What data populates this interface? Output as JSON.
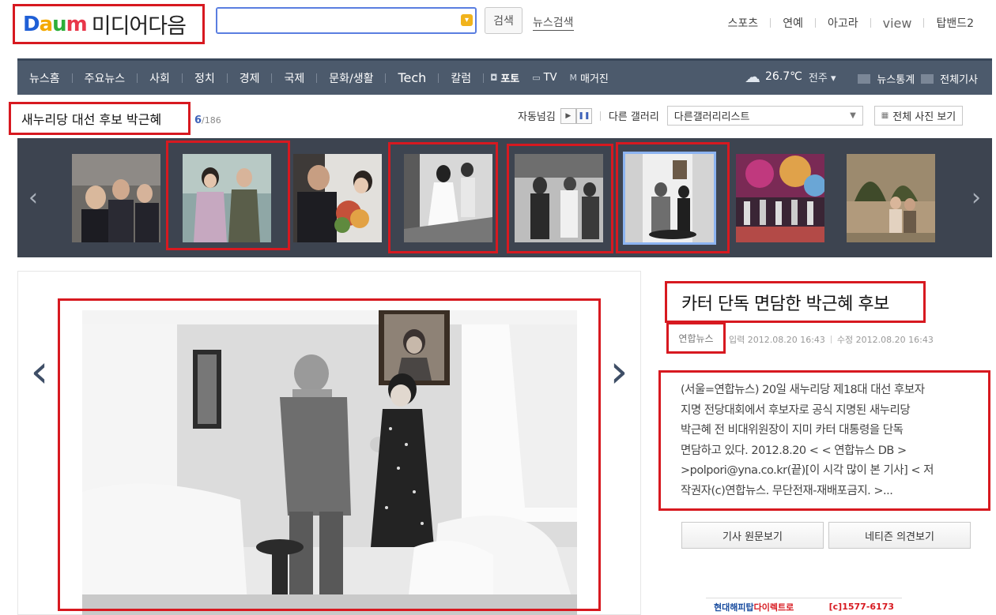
{
  "header": {
    "logo_brand": "Daum",
    "logo_text": "미디어다음",
    "search_value": "",
    "search_button": "검색",
    "news_search": "뉴스검색",
    "top_links": [
      "스포츠",
      "연예",
      "아고라",
      "view",
      "탑밴드2"
    ]
  },
  "nav": {
    "items": [
      "뉴스홈",
      "주요뉴스",
      "사회",
      "정치",
      "경제",
      "국제",
      "문화/생활",
      "Tech",
      "칼럼"
    ],
    "sub_items": [
      {
        "label": "포토",
        "icon": "camera-icon",
        "active": true
      },
      {
        "label": "TV",
        "icon": "tv-icon",
        "active": false
      },
      {
        "label": "매거진",
        "icon": "magazine-icon",
        "active": false
      }
    ],
    "weather": {
      "temp": "26.7℃",
      "city": "전주",
      "icon": "partly-cloudy-icon"
    },
    "right_links": [
      "뉴스통계",
      "전체기사"
    ]
  },
  "gallery": {
    "title": "새누리당 대선 후보 박근혜",
    "current": "6",
    "total": "/186",
    "autoplay_label": "자동넘김",
    "other_gallery_label": "다른 갤러리",
    "other_gallery_select": "다른갤러리리스트",
    "view_all": "전체 사진 보기"
  },
  "article": {
    "title": "카터 단독 면담한 박근혜 후보",
    "source": "연합뉴스",
    "input_time": "입력 2012.08.20 16:43",
    "edit_time": "수정 2012.08.20 16:43",
    "body_lines": [
      "(서울=연합뉴스) 20일 새누리당 제18대 대선 후보자",
      "지명 전당대회에서 후보자로 공식 지명된 새누리당",
      "박근혜 전 비대위원장이 지미 카터 대통령을 단독",
      "면담하고 있다. 2012.8.20 < < 연합뉴스 DB >",
      ">polpori@yna.co.kr(끝)[이 시각 많이 본 기사] < 저",
      "작권자(c)연합뉴스. 무단전재-재배포금지. >..."
    ],
    "btn_original": "기사 원문보기",
    "btn_opinion": "네티즌 의견보기"
  },
  "ad": {
    "brand_a": "현대해피탑",
    "brand_b": "다이렉트로",
    "phone": "[c]1577-6173"
  }
}
